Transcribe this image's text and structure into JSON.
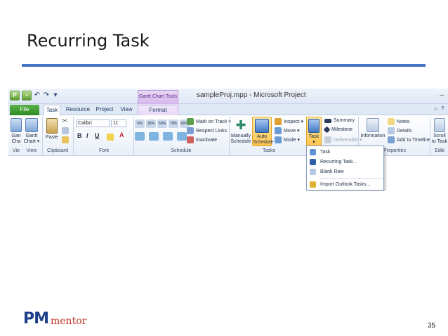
{
  "slide": {
    "title": "Recurring Task",
    "page_number": "35",
    "logo_pm": "PM",
    "logo_mentor": "mentor",
    "accent_color": "#4472c4"
  },
  "window": {
    "context_tools": "Gantt Chart Tools",
    "title": "sampleProj.mpp  -  Microsoft Project",
    "minimize": "–",
    "help": "?"
  },
  "qat": {
    "save_icon": "save-icon",
    "undo": "↶",
    "redo": "↷",
    "customize": "▾"
  },
  "tabs": [
    {
      "label": "File"
    },
    {
      "label": "Task"
    },
    {
      "label": "Resource"
    },
    {
      "label": "Project"
    },
    {
      "label": "View"
    },
    {
      "label": "Format"
    }
  ],
  "tab_extras": {
    "help": "?",
    "collapse": "⌂"
  },
  "ribbon": {
    "view": {
      "gantt_chart_1": "Gan",
      "gantt_chart_1b": "Cha",
      "gantt_chart_2": "Gantt",
      "gantt_chart_2b": "Chart ▾",
      "label_a": "Vie",
      "label_b": "View"
    },
    "clipboard": {
      "paste": "Paste",
      "cut": "✂",
      "label": "Clipboard"
    },
    "font": {
      "font_name": "Calibri",
      "font_size": "11",
      "bold": "B",
      "italic": "I",
      "underline": "U",
      "label": "Font",
      "font_color": "A"
    },
    "schedule": {
      "pct": [
        "0%",
        "25%",
        "50%",
        "75%",
        "100%"
      ],
      "mark_on_track": "Mark on Track ▾",
      "respect_links": "Respect Links",
      "inactivate": "Inactivate",
      "label": "Schedule"
    },
    "tasks": {
      "manually_schedule_a": "Manually",
      "manually_schedule_b": "Schedule",
      "auto_schedule_a": "Auto",
      "auto_schedule_b": "Schedule",
      "inspect": "Inspect ▾",
      "move": "Move ▾",
      "mode": "Mode ▾",
      "label": "Tasks"
    },
    "insert": {
      "task_a": "Task",
      "task_b": "▾",
      "summary": "Summary",
      "milestone": "Milestone",
      "deliverable": "Deliverable ▾"
    },
    "properties": {
      "information": "Information",
      "notes": "Notes",
      "details": "Details",
      "add_to_timeline": "Add to Timeline",
      "label": "Properties"
    },
    "editing": {
      "scroll_a": "Scroll",
      "scroll_b": "to Task",
      "label": "Editi"
    }
  },
  "task_menu": [
    {
      "label": "Task",
      "icon": "task-icon"
    },
    {
      "label": "Recurring Task...",
      "icon": "recurring-task-icon"
    },
    {
      "label": "Blank Row",
      "icon": "blank-row-icon"
    },
    {
      "label": "Import Outlook Tasks...",
      "icon": "import-outlook-icon"
    }
  ]
}
